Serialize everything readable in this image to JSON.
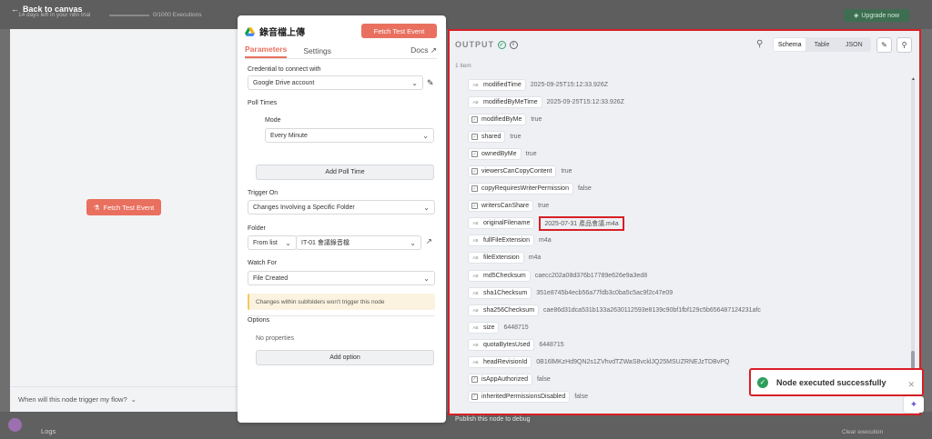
{
  "top": {
    "back_label": "Back to canvas",
    "trial_text": "14 days left in your n8n trial",
    "executions_text": "0/1000 Executions",
    "upgrade_label": "Upgrade now"
  },
  "left_panel": {
    "fetch_label": "Fetch Test Event",
    "trigger_question": "When will this node trigger my flow?"
  },
  "params": {
    "title": "錄音檔上傳",
    "fetch_label": "Fetch Test Event",
    "tabs": [
      "Parameters",
      "Settings"
    ],
    "docs_label": "Docs",
    "credential_label": "Credential to connect with",
    "credential_value": "Google Drive account",
    "poll_times_label": "Poll Times",
    "mode_label": "Mode",
    "mode_value": "Every Minute",
    "add_poll_label": "Add Poll Time",
    "trigger_on_label": "Trigger On",
    "trigger_on_value": "Changes Involving a Specific Folder",
    "folder_label": "Folder",
    "folder_source": "From list",
    "folder_value": "IT-01 會議錄音檔",
    "watch_for_label": "Watch For",
    "watch_for_value": "File Created",
    "notice": "Changes within subfolders won't trigger this node",
    "options_label": "Options",
    "no_properties": "No properties",
    "add_option_label": "Add option"
  },
  "output": {
    "title": "OUTPUT",
    "item_count": "1 item",
    "views": [
      "Schema",
      "Table",
      "JSON"
    ],
    "active_view": "Schema",
    "rows": [
      {
        "type": "AB",
        "key": "modifiedTime",
        "value": "2025-09-25T15:12:33.926Z"
      },
      {
        "type": "AB",
        "key": "modifiedByMeTime",
        "value": "2025-09-25T15:12:33.926Z"
      },
      {
        "type": "bool",
        "key": "modifiedByMe",
        "value": "true"
      },
      {
        "type": "bool",
        "key": "shared",
        "value": "true"
      },
      {
        "type": "bool",
        "key": "ownedByMe",
        "value": "true"
      },
      {
        "type": "bool",
        "key": "viewersCanCopyContent",
        "value": "true"
      },
      {
        "type": "bool",
        "key": "copyRequiresWriterPermission",
        "value": "false"
      },
      {
        "type": "bool",
        "key": "writersCanShare",
        "value": "true"
      },
      {
        "type": "AB",
        "key": "originalFilename",
        "value": "2025-07-31 產品會議.m4a",
        "highlight": true
      },
      {
        "type": "AB",
        "key": "fullFileExtension",
        "value": "m4a"
      },
      {
        "type": "AB",
        "key": "fileExtension",
        "value": "m4a"
      },
      {
        "type": "AB",
        "key": "md5Checksum",
        "value": "caecc202a08d376b17789e626e9a3ed8"
      },
      {
        "type": "AB",
        "key": "sha1Checksum",
        "value": "351e8745b4ecb56a77fdb3c0ba5c5ac9f2c47e09"
      },
      {
        "type": "AB",
        "key": "sha256Checksum",
        "value": "cae86d31dca531b133a2630112593e8139c90bf1fbf129c5b656487124231afc"
      },
      {
        "type": "AB",
        "key": "size",
        "value": "6448715"
      },
      {
        "type": "AB",
        "key": "quotaBytesUsed",
        "value": "6448715"
      },
      {
        "type": "AB",
        "key": "headRevisionId",
        "value": "0B16lMKzHd9QN2s1ZVhvdTZWaS8vcklJQ25MSUZRNEJzTDBvPQ"
      },
      {
        "type": "bool",
        "key": "isAppAuthorized",
        "value": "false"
      },
      {
        "type": "bool",
        "key": "inheritedPermissionsDisabled",
        "value": "false"
      }
    ]
  },
  "toast": {
    "message": "Node executed successfully"
  },
  "bottom": {
    "logs_label": "Logs",
    "clear_label": "Clear execution",
    "hint": "Publish this node to debug"
  }
}
